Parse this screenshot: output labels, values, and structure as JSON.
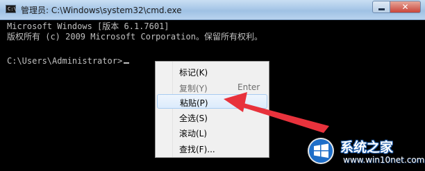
{
  "window": {
    "title": "管理员: C:\\Windows\\system32\\cmd.exe",
    "icon": "cmd-icon",
    "icon_glyph": "C:\\",
    "buttons": {
      "minimize": "minimize-icon",
      "close_glyph": "✕"
    }
  },
  "console": {
    "lines": [
      "Microsoft Windows [版本 6.1.7601]",
      "版权所有 (c) 2009 Microsoft Corporation。保留所有权利。",
      "",
      "C:\\Users\\Administrator>"
    ],
    "text_color": "#c0c0c0",
    "background": "#000000"
  },
  "context_menu": {
    "items": [
      {
        "label": "标记(K)",
        "accelerator": "",
        "enabled": true,
        "highlighted": false
      },
      {
        "label": "复制(Y)",
        "accelerator": "Enter",
        "enabled": false,
        "highlighted": false
      },
      {
        "label": "粘贴(P)",
        "accelerator": "",
        "enabled": true,
        "highlighted": true
      },
      {
        "label": "全选(S)",
        "accelerator": "",
        "enabled": true,
        "highlighted": false
      },
      {
        "label": "滚动(L)",
        "accelerator": "",
        "enabled": true,
        "highlighted": false
      },
      {
        "label": "查找(F)...",
        "accelerator": "",
        "enabled": true,
        "highlighted": false
      }
    ]
  },
  "annotation": {
    "arrow_color": "#e8323c",
    "points_to": "粘贴(P)"
  },
  "watermark": {
    "title": "系统之家",
    "url": "www.win10net.com",
    "logo": "windows-logo-icon"
  }
}
